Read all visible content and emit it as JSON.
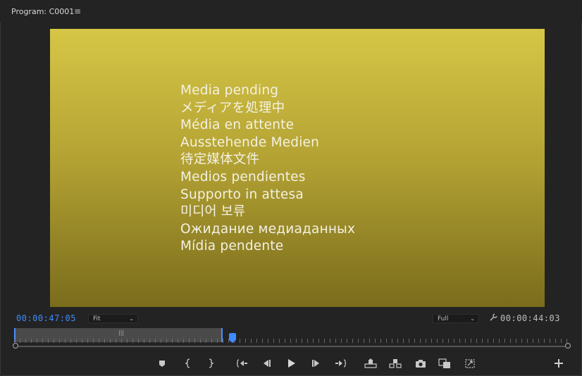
{
  "panel": {
    "title": "Program: C0001",
    "menu_glyph": "≡"
  },
  "viewer": {
    "pending_lines": [
      "Media pending",
      "メディアを処理中",
      "Média en attente",
      "Ausstehende Medien",
      "待定媒体文件",
      "Medios pendientes",
      "Supporto in attesa",
      "미디어 보류",
      "Ожидание медиаданных",
      "Mídia pendente"
    ]
  },
  "controls": {
    "current_timecode": "00:00:47:05",
    "duration_timecode": "00:00:44:03",
    "zoom_select": "Fit",
    "resolution_select": "Full",
    "chevron": "⌄"
  },
  "colors": {
    "accent": "#3d8bff",
    "background": "#232323"
  },
  "icons": [
    "marker-icon",
    "mark-in-icon",
    "mark-out-icon",
    "go-to-in-icon",
    "step-back-icon",
    "play-icon",
    "step-forward-icon",
    "go-to-out-icon",
    "lift-icon",
    "extract-icon",
    "export-frame-icon",
    "comparison-view-icon",
    "toggle-proxies-icon",
    "add-button-icon",
    "wrench-icon"
  ]
}
